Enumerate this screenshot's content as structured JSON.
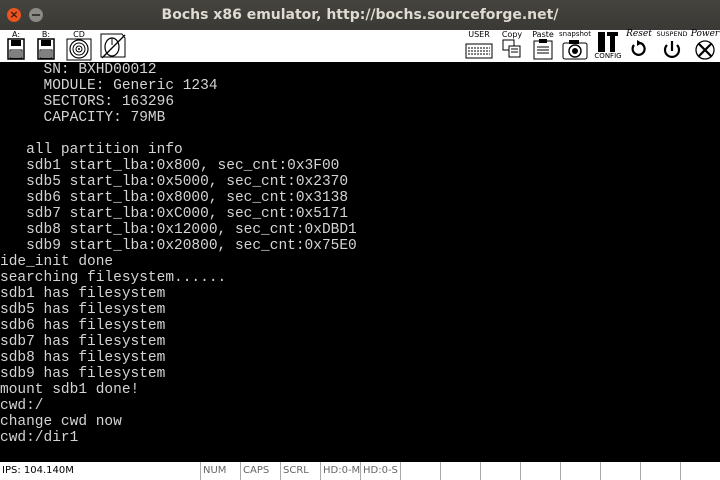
{
  "window": {
    "title": "Bochs x86 emulator, http://bochs.sourceforge.net/",
    "close_glyph": "×"
  },
  "toolbar": {
    "floppy_a": "A:",
    "floppy_b": "B:",
    "cdrom": "CD",
    "user": "USER",
    "copy": "Copy",
    "paste": "Paste",
    "snapshot": "snapshot",
    "config": "CONFIG",
    "reset": "Reset",
    "suspend": "SUSPEND",
    "power": "Power"
  },
  "console_lines": [
    "     SN: BXHD00012",
    "     MODULE: Generic 1234",
    "     SECTORS: 163296",
    "     CAPACITY: 79MB",
    "",
    "   all partition info",
    "   sdb1 start_lba:0x800, sec_cnt:0x3F00",
    "   sdb5 start_lba:0x5000, sec_cnt:0x2370",
    "   sdb6 start_lba:0x8000, sec_cnt:0x3138",
    "   sdb7 start_lba:0xC000, sec_cnt:0x5171",
    "   sdb8 start_lba:0x12000, sec_cnt:0xDBD1",
    "   sdb9 start_lba:0x20800, sec_cnt:0x75E0",
    "ide_init done",
    "searching filesystem......",
    "sdb1 has filesystem",
    "sdb5 has filesystem",
    "sdb6 has filesystem",
    "sdb7 has filesystem",
    "sdb8 has filesystem",
    "sdb9 has filesystem",
    "mount sdb1 done!",
    "cwd:/",
    "change cwd now",
    "cwd:/dir1"
  ],
  "status": {
    "ips": "IPS: 104.140M",
    "num": "NUM",
    "caps": "CAPS",
    "scrl": "SCRL",
    "hd0m": "HD:0-M",
    "hd0s": "HD:0-S"
  }
}
